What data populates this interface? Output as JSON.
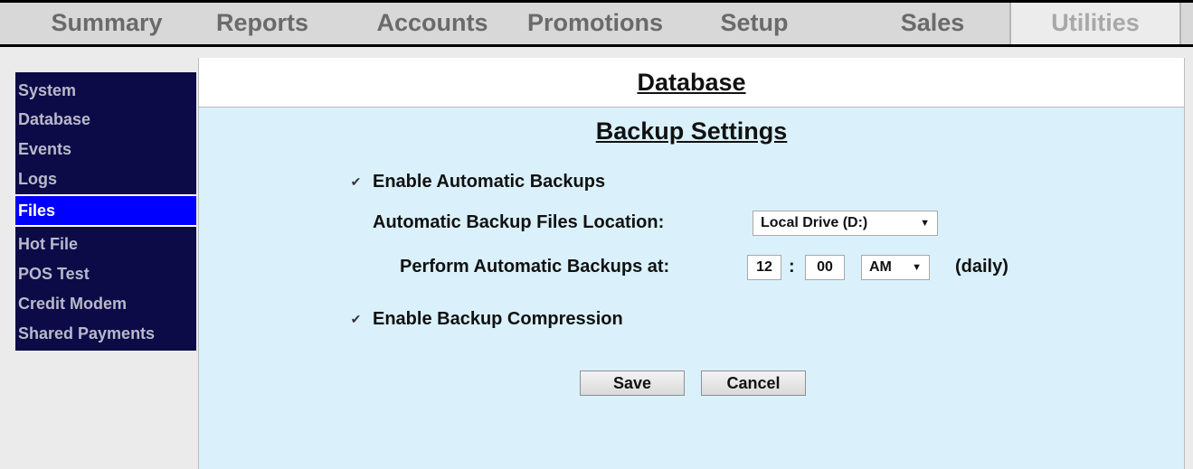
{
  "topnav": {
    "tabs": [
      {
        "label": "Summary"
      },
      {
        "label": "Reports"
      },
      {
        "label": "Accounts"
      },
      {
        "label": "Promotions"
      },
      {
        "label": "Setup"
      },
      {
        "label": "Sales"
      },
      {
        "label": "Utilities",
        "active": true
      }
    ]
  },
  "sidebar": {
    "items": [
      {
        "label": "System"
      },
      {
        "label": "Database"
      },
      {
        "label": "Events"
      },
      {
        "label": "Logs"
      },
      {
        "label": "Files",
        "active": true
      },
      {
        "label": "Hot File"
      },
      {
        "label": "POS Test"
      },
      {
        "label": "Credit Modem"
      },
      {
        "label": "Shared Payments"
      }
    ]
  },
  "main": {
    "page_title": "Database",
    "section_title": "Backup Settings",
    "enable_auto_backups": {
      "label": "Enable Automatic Backups",
      "checked": true
    },
    "location": {
      "label": "Automatic Backup Files Location:",
      "value": "Local Drive (D:)"
    },
    "schedule": {
      "label": "Perform Automatic Backups at:",
      "hour": "12",
      "separator": ":",
      "minute": "00",
      "ampm": "AM",
      "suffix": "(daily)"
    },
    "enable_compression": {
      "label": "Enable Backup Compression",
      "checked": true
    },
    "save_label": "Save",
    "cancel_label": "Cancel"
  },
  "colors": {
    "sidebar_bg": "#0c0a47",
    "sidebar_active": "#0000ff",
    "content_bg": "#daf1fc"
  }
}
